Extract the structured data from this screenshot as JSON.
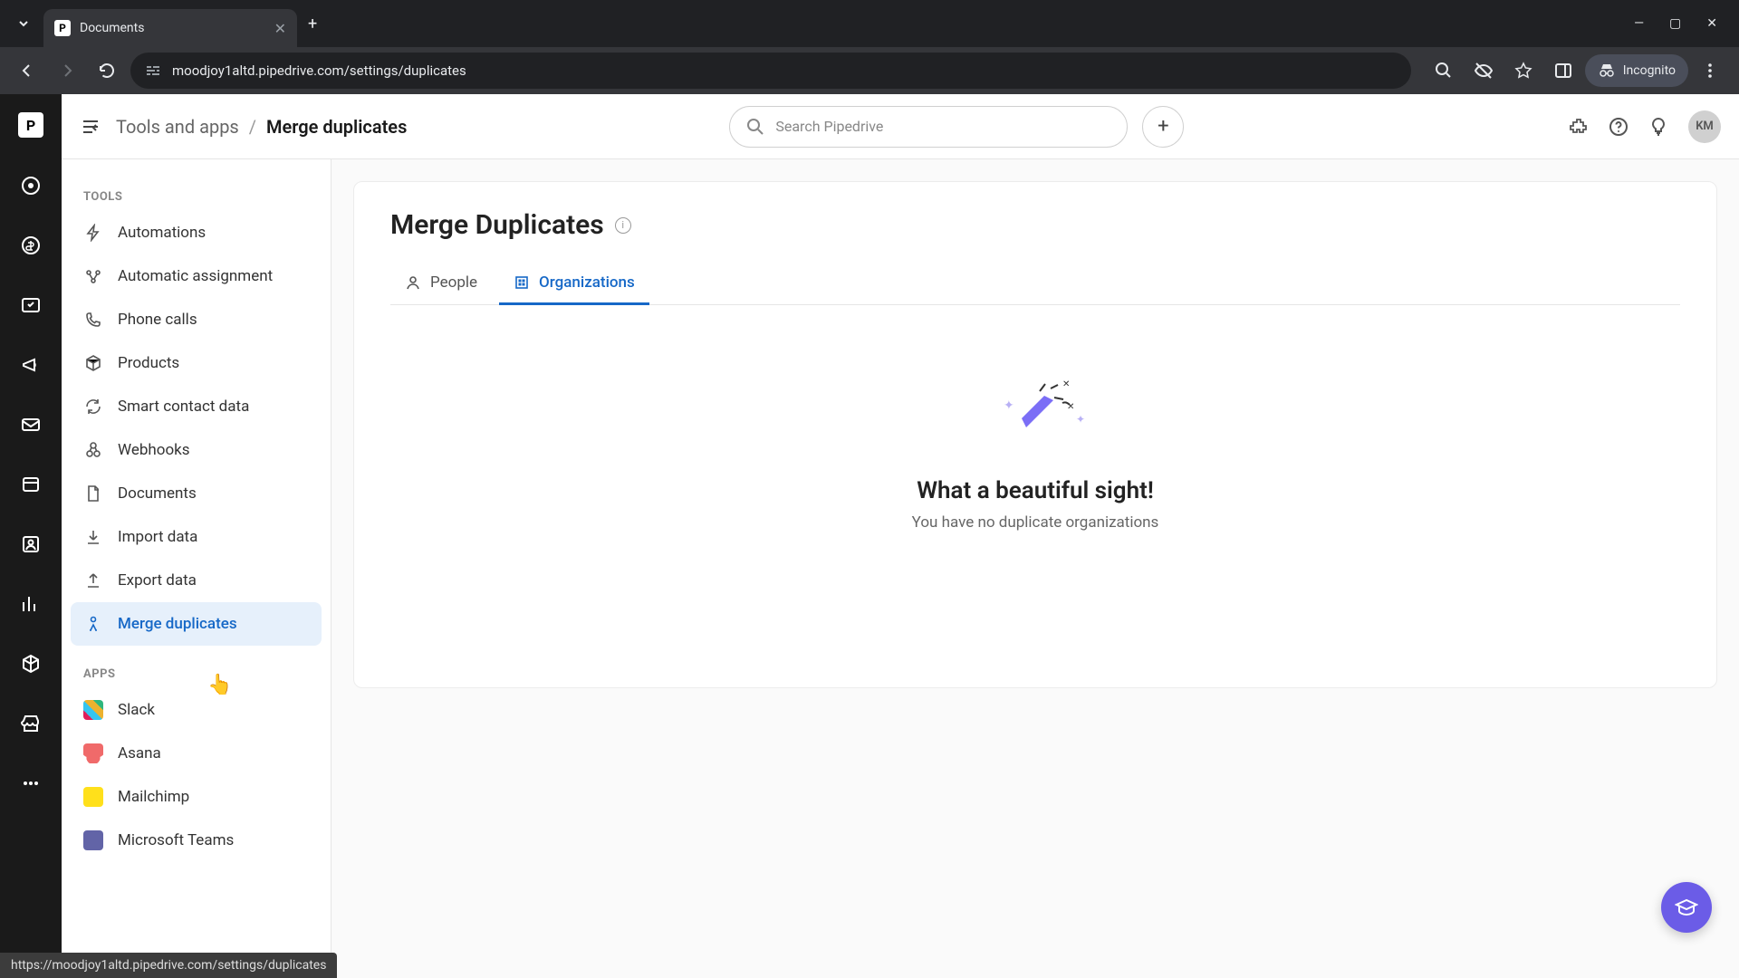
{
  "browser": {
    "tab_title": "Documents",
    "url": "moodjoy1altd.pipedrive.com/settings/duplicates",
    "incognito_label": "Incognito",
    "status_url": "https://moodjoy1altd.pipedrive.com/settings/duplicates"
  },
  "topbar": {
    "breadcrumb_root": "Tools and apps",
    "breadcrumb_current": "Merge duplicates",
    "search_placeholder": "Search Pipedrive",
    "avatar_initials": "KM"
  },
  "sidebar": {
    "section_tools": "TOOLS",
    "section_apps": "APPS",
    "tools": [
      {
        "label": "Automations"
      },
      {
        "label": "Automatic assignment"
      },
      {
        "label": "Phone calls"
      },
      {
        "label": "Products"
      },
      {
        "label": "Smart contact data"
      },
      {
        "label": "Webhooks"
      },
      {
        "label": "Documents"
      },
      {
        "label": "Import data"
      },
      {
        "label": "Export data"
      },
      {
        "label": "Merge duplicates"
      }
    ],
    "apps": [
      {
        "label": "Slack"
      },
      {
        "label": "Asana"
      },
      {
        "label": "Mailchimp"
      },
      {
        "label": "Microsoft Teams"
      }
    ]
  },
  "panel": {
    "title": "Merge Duplicates",
    "tab_people": "People",
    "tab_organizations": "Organizations",
    "empty_title": "What a beautiful sight!",
    "empty_sub": "You have no duplicate organizations"
  }
}
